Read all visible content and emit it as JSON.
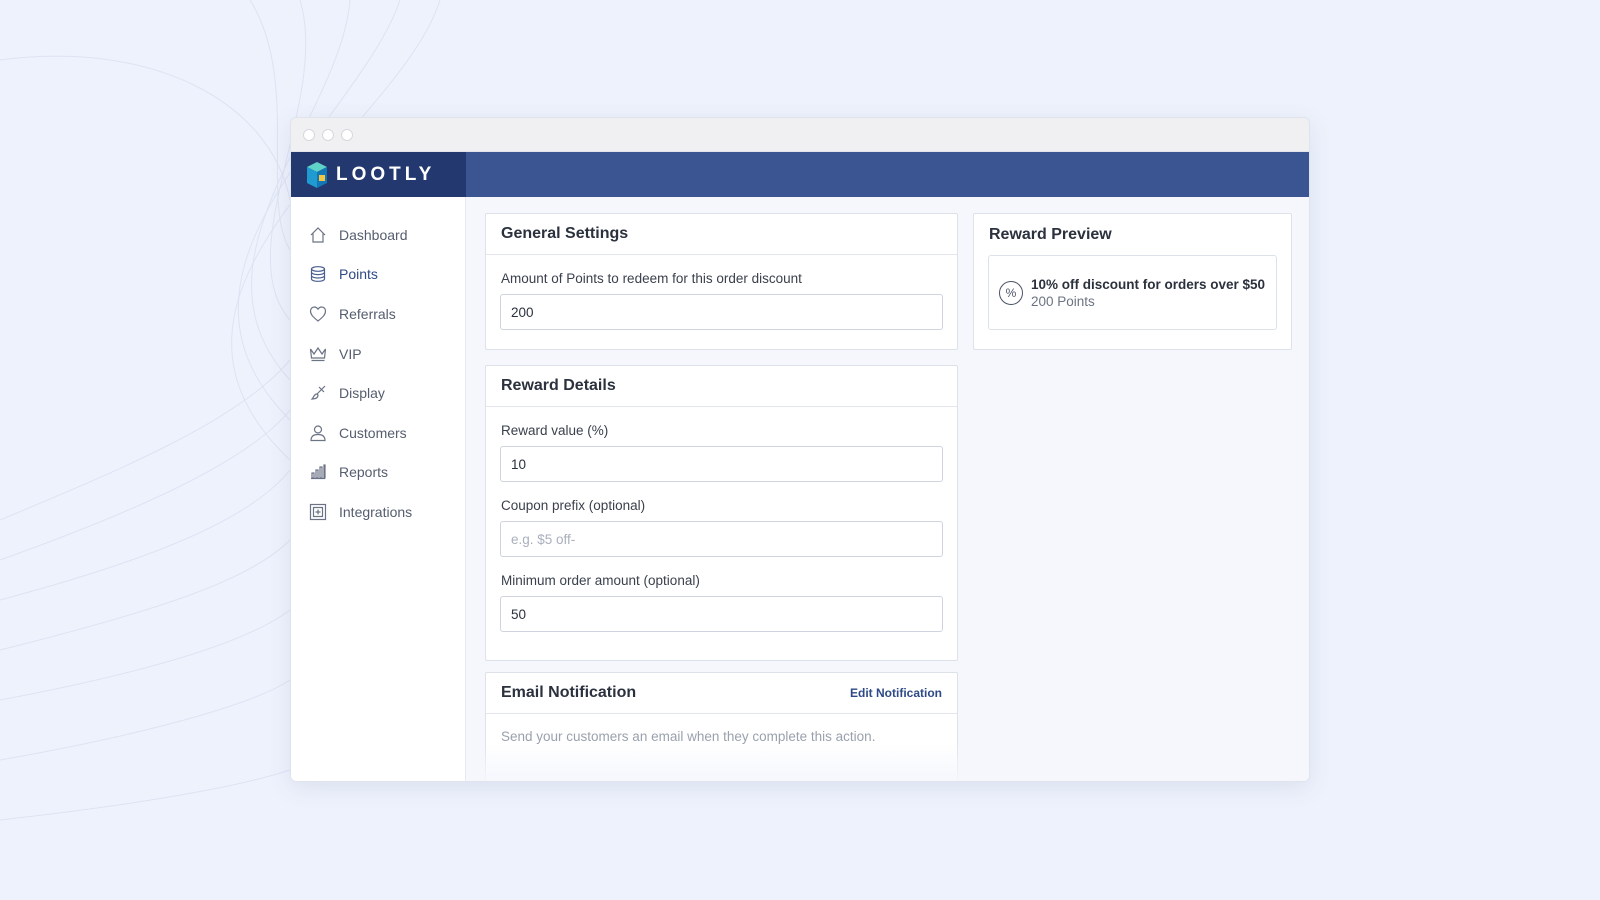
{
  "brand": {
    "name": "LOOTLY"
  },
  "sidebar": {
    "items": [
      {
        "label": "Dashboard",
        "icon": "home-icon"
      },
      {
        "label": "Points",
        "icon": "coins-icon",
        "active": true
      },
      {
        "label": "Referrals",
        "icon": "heart-icon"
      },
      {
        "label": "VIP",
        "icon": "crown-icon"
      },
      {
        "label": "Display",
        "icon": "brush-icon"
      },
      {
        "label": "Customers",
        "icon": "user-icon"
      },
      {
        "label": "Reports",
        "icon": "bar-chart-icon"
      },
      {
        "label": "Integrations",
        "icon": "plus-square-icon"
      }
    ]
  },
  "general_settings": {
    "title": "General Settings",
    "points_label": "Amount of Points to redeem for this order discount",
    "points_value": "200"
  },
  "reward_details": {
    "title": "Reward Details",
    "reward_value_label": "Reward value (%)",
    "reward_value": "10",
    "coupon_prefix_label": "Coupon prefix (optional)",
    "coupon_prefix_placeholder": "e.g. $5 off-",
    "min_order_label": "Minimum order amount (optional)",
    "min_order_value": "50"
  },
  "email_notification": {
    "title": "Email Notification",
    "edit_link": "Edit Notification",
    "description": "Send your customers an email when they complete this action."
  },
  "reward_preview": {
    "title": "Reward Preview",
    "icon_symbol": "%",
    "reward_title": "10% off discount for orders over $50",
    "reward_points": "200 Points"
  },
  "colors": {
    "accent": "#2e4a86",
    "topbar": "#3a5591",
    "logo_bg": "#22386e",
    "background": "#eef2fc"
  }
}
